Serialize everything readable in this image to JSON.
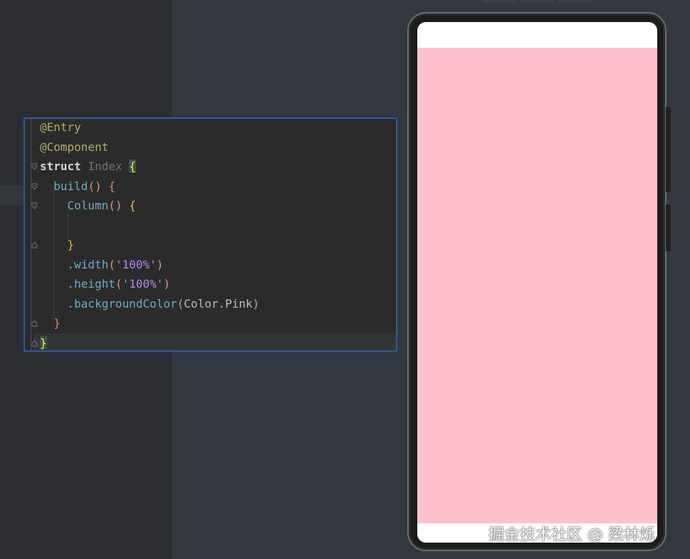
{
  "editor": {
    "lines": [
      {
        "parts": [
          {
            "t": "@Entry",
            "c": "ann"
          }
        ]
      },
      {
        "parts": [
          {
            "t": "@Component",
            "c": "ann"
          }
        ]
      },
      {
        "parts": [
          {
            "t": "struct",
            "c": "struct-kw"
          },
          {
            "t": " ",
            "c": "plain"
          },
          {
            "t": "Index",
            "c": "cls"
          },
          {
            "t": " ",
            "c": "plain"
          },
          {
            "t": "{",
            "c": "hlbrace"
          }
        ]
      },
      {
        "parts": [
          {
            "t": "  ",
            "c": "plain"
          },
          {
            "t": "build",
            "c": "fn2"
          },
          {
            "t": "()",
            "c": "brp"
          },
          {
            "t": " ",
            "c": "plain"
          },
          {
            "t": "{",
            "c": "br2"
          }
        ]
      },
      {
        "parts": [
          {
            "t": "    ",
            "c": "plain"
          },
          {
            "t": "Column",
            "c": "fn2"
          },
          {
            "t": "()",
            "c": "brp"
          },
          {
            "t": " ",
            "c": "plain"
          },
          {
            "t": "{",
            "c": "br"
          }
        ]
      },
      {
        "parts": [
          {
            "t": "",
            "c": "plain"
          }
        ]
      },
      {
        "parts": [
          {
            "t": "    ",
            "c": "plain"
          },
          {
            "t": "}",
            "c": "br"
          }
        ]
      },
      {
        "parts": [
          {
            "t": "    ",
            "c": "plain"
          },
          {
            "t": ".width",
            "c": "fn2"
          },
          {
            "t": "(",
            "c": "brp"
          },
          {
            "t": "'100%'",
            "c": "str"
          },
          {
            "t": ")",
            "c": "brp"
          }
        ]
      },
      {
        "parts": [
          {
            "t": "    ",
            "c": "plain"
          },
          {
            "t": ".height",
            "c": "fn2"
          },
          {
            "t": "(",
            "c": "brp"
          },
          {
            "t": "'100%'",
            "c": "str"
          },
          {
            "t": ")",
            "c": "brp"
          }
        ]
      },
      {
        "parts": [
          {
            "t": "    ",
            "c": "plain"
          },
          {
            "t": ".backgroundColor",
            "c": "fn2"
          },
          {
            "t": "(",
            "c": "brp"
          },
          {
            "t": "Color.Pink",
            "c": "plain"
          },
          {
            "t": ")",
            "c": "brp"
          }
        ]
      },
      {
        "parts": [
          {
            "t": "  ",
            "c": "plain"
          },
          {
            "t": "}",
            "c": "br2"
          }
        ]
      },
      {
        "parts": [
          {
            "t": "}",
            "c": "hlbrace"
          }
        ]
      }
    ],
    "fold_marks": [
      {
        "line": 2,
        "kind": "open"
      },
      {
        "line": 3,
        "kind": "open"
      },
      {
        "line": 4,
        "kind": "open"
      },
      {
        "line": 6,
        "kind": "close"
      },
      {
        "line": 10,
        "kind": "close"
      },
      {
        "line": 11,
        "kind": "close"
      }
    ]
  },
  "preview": {
    "background_color": "#ffc0cb",
    "status_bar_color": "#ffffff"
  },
  "watermark": "掘金技术社区 @ 梁林烁",
  "colors": {
    "annotation": "#b3ae60",
    "function": "#6aaecf",
    "string": "#b189f5",
    "brace_yellow": "#e8ba36",
    "brace_orange": "#cf8e6d",
    "accent_border": "#2f5d8f"
  }
}
